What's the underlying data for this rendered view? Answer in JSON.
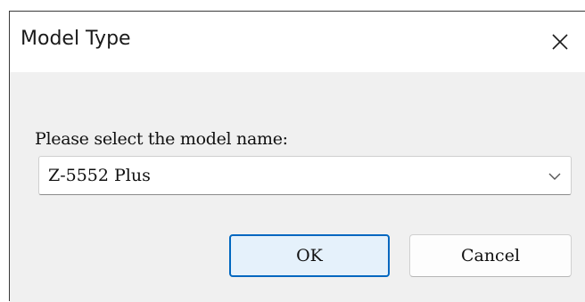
{
  "window": {
    "title": "Model Type",
    "close_icon": "close-icon"
  },
  "form": {
    "prompt": "Please select the model name:",
    "model_select": {
      "selected": "Z-5552 Plus",
      "icon": "chevron-down-icon"
    }
  },
  "buttons": {
    "ok_label": "OK",
    "cancel_label": "Cancel"
  },
  "colors": {
    "accent": "#0067c0",
    "ok_fill": "#e5f1fb",
    "dialog_bg": "#f0f0f0"
  }
}
